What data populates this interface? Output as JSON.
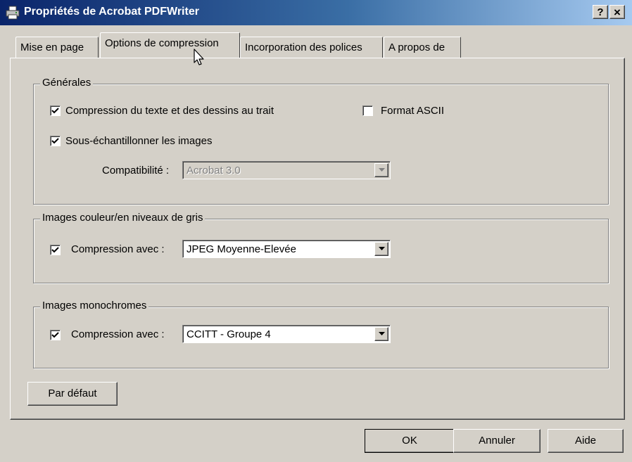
{
  "window": {
    "title": "Propriétés de Acrobat PDFWriter",
    "help_button": "?",
    "close_button": "×"
  },
  "tabs": [
    {
      "label": "Mise en page",
      "selected": false
    },
    {
      "label": "Options de compression",
      "selected": true
    },
    {
      "label": "Incorporation des polices",
      "selected": false
    },
    {
      "label": "A propos de",
      "selected": false
    }
  ],
  "general": {
    "legend": "Générales",
    "compress_text": {
      "label": "Compression du texte et des dessins au trait",
      "checked": true
    },
    "ascii_format": {
      "label": "Format ASCII",
      "checked": false
    },
    "downsample": {
      "label": "Sous-échantillonner les images",
      "checked": true
    },
    "compatibility": {
      "label": "Compatibilité :",
      "value": "Acrobat 3.0",
      "enabled": false
    }
  },
  "color_images": {
    "legend": "Images couleur/en niveaux de gris",
    "compress": {
      "label": "Compression avec :",
      "checked": true
    },
    "method": "JPEG Moyenne-Elevée"
  },
  "mono_images": {
    "legend": "Images monochromes",
    "compress": {
      "label": "Compression avec :",
      "checked": true
    },
    "method": "CCITT - Groupe 4"
  },
  "buttons": {
    "defaults": "Par défaut",
    "ok": "OK",
    "cancel": "Annuler",
    "help": "Aide"
  },
  "icons": {
    "app": "printer-icon",
    "check": "checkmark-icon",
    "dropdown": "down-arrow-icon",
    "cursor": "mouse-pointer-icon"
  }
}
